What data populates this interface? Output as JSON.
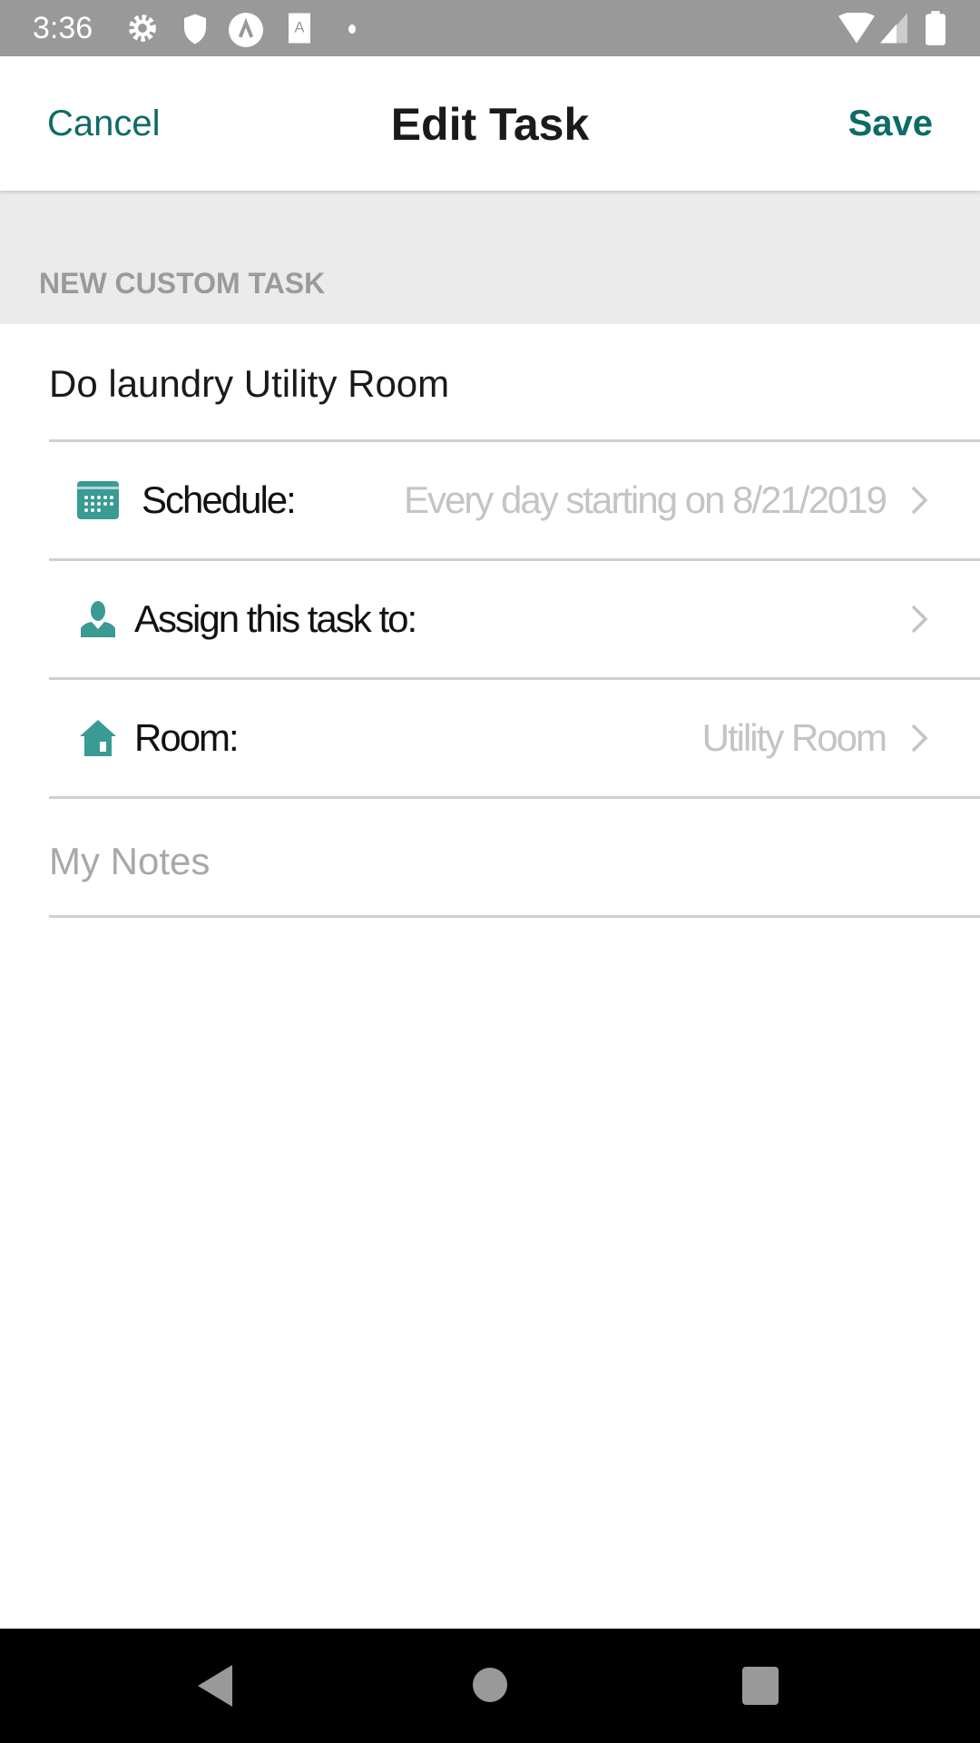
{
  "status_bar": {
    "time": "3:36",
    "icons": [
      "gear-icon",
      "shield-icon",
      "a-circle-icon",
      "a-box-icon",
      "dot-icon",
      "wifi-icon",
      "signal-icon",
      "battery-icon"
    ]
  },
  "header": {
    "cancel": "Cancel",
    "title": "Edit Task",
    "save": "Save"
  },
  "section": {
    "label": "NEW CUSTOM TASK"
  },
  "task": {
    "name": "Do laundry Utility Room"
  },
  "rows": [
    {
      "label": "Schedule:",
      "value": "Every day starting on 8/21/2019",
      "icon": "calendar-icon"
    },
    {
      "label": "Assign this task to:",
      "value": "",
      "icon": "person-icon"
    },
    {
      "label": "Room:",
      "value": "Utility Room",
      "icon": "house-icon"
    }
  ],
  "notes": {
    "placeholder": "My Notes"
  },
  "colors": {
    "accent": "#0e6b66",
    "icon": "#3a9a94",
    "status_bar": "#999999"
  }
}
